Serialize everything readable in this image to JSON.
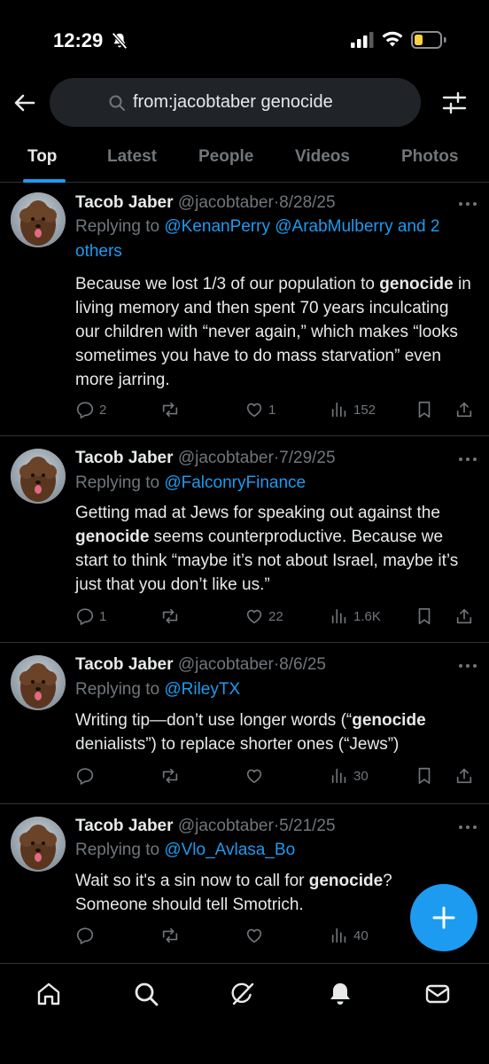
{
  "status_bar": {
    "time": "12:29"
  },
  "search": {
    "query": "from:jacobtaber genocide"
  },
  "tabs": [
    {
      "label": "Top"
    },
    {
      "label": "Latest"
    },
    {
      "label": "People"
    },
    {
      "label": "Videos"
    },
    {
      "label": "Photos"
    }
  ],
  "tweets": [
    {
      "name": "Tacob Jaber",
      "handle": "@jacobtaber",
      "sep": "·",
      "date": "8/28/25",
      "replying_prefix": "Replying to ",
      "replying_mentions": "@KenanPerry @ArabMulberry and 2 others",
      "body_pre": "Because we lost 1/3 of our population to ",
      "body_bold": "genocide",
      "body_post": " in living memory and then spent 70 years inculcating our children with “never again,” which makes “looks sometimes you have to do mass starvation” even more jarring.",
      "replies": "2",
      "reposts": "",
      "likes": "1",
      "views": "152"
    },
    {
      "name": "Tacob Jaber",
      "handle": "@jacobtaber",
      "sep": "·",
      "date": "7/29/25",
      "replying_prefix": "Replying to ",
      "replying_mentions": "@FalconryFinance",
      "body_pre": "Getting mad at Jews for speaking out against the ",
      "body_bold": "genocide",
      "body_post": " seems counterproductive. Because we start to think “maybe it’s not about Israel, maybe it’s just that you don’t like us.”",
      "replies": "1",
      "reposts": "",
      "likes": "22",
      "views": "1.6K"
    },
    {
      "name": "Tacob Jaber",
      "handle": "@jacobtaber",
      "sep": "·",
      "date": "8/6/25",
      "replying_prefix": "Replying to ",
      "replying_mentions": "@RileyTX",
      "body_pre": "Writing tip—don’t use longer words (“",
      "body_bold": "genocide",
      "body_post": " denialists”) to replace shorter ones (“Jews”)",
      "replies": "",
      "reposts": "",
      "likes": "",
      "views": "30"
    },
    {
      "name": "Tacob Jaber",
      "handle": "@jacobtaber",
      "sep": "·",
      "date": "5/21/25",
      "replying_prefix": "Replying to ",
      "replying_mentions": "@Vlo_Avlasa_Bo",
      "body_pre": "Wait so it's a sin now to call for ",
      "body_bold": "genocide",
      "body_post": "? Someone should tell Smotrich.",
      "replies": "",
      "reposts": "",
      "likes": "",
      "views": "40"
    }
  ],
  "colors": {
    "accent": "#1d9bf0",
    "background": "#000000",
    "muted": "#71767b",
    "text": "#e7e9ea",
    "battery_level": "#f7d046"
  },
  "icons": {
    "status": [
      "bell-off-icon",
      "signal-icon",
      "wifi-icon",
      "battery-icon"
    ],
    "header": [
      "back-arrow-icon",
      "search-icon",
      "filter-sliders-icon"
    ],
    "tweet_actions": [
      "reply-icon",
      "repost-icon",
      "like-icon",
      "views-icon",
      "bookmark-icon",
      "share-icon"
    ],
    "fab": "plus-icon",
    "bottom_nav": [
      "home-icon",
      "search-icon",
      "grok-icon",
      "notifications-icon",
      "messages-icon"
    ]
  }
}
